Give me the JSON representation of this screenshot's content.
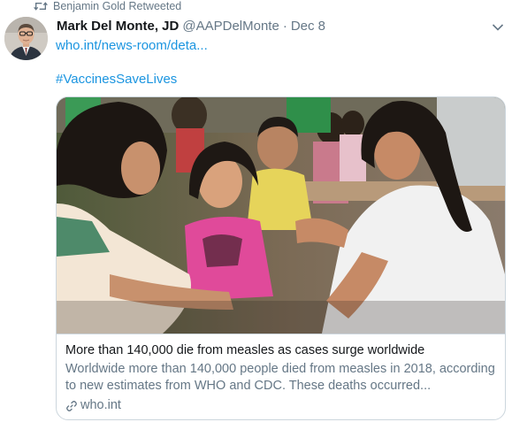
{
  "retweet": {
    "text": "Benjamin Gold Retweeted",
    "icon": "retweet-icon"
  },
  "author": {
    "display_name": "Mark Del Monte, JD",
    "handle": "@AAPDelMonte",
    "separator": "·",
    "date": "Dec 8"
  },
  "tweet": {
    "link_text": "who.int/news-room/deta...",
    "hashtag": "#VaccinesSaveLives"
  },
  "card": {
    "title": "More than 140,000 die from measles as cases surge worldwide",
    "description": "Worldwide more than 140,000 people died from measles in 2018, according to new estimates from WHO and CDC. These deaths occurred...",
    "domain": "who.int"
  },
  "colors": {
    "link": "#1b95e0",
    "secondary_text": "#657786",
    "primary_text": "#14171a",
    "border": "#ccd6dd"
  }
}
